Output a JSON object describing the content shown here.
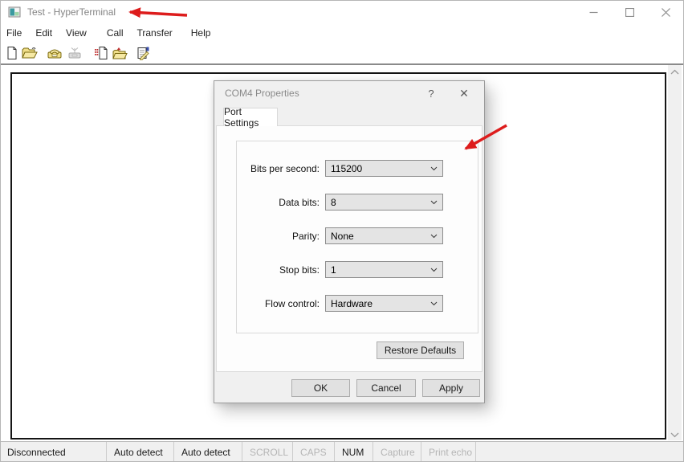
{
  "window": {
    "title": "Test - HyperTerminal"
  },
  "menu": {
    "items": [
      "File",
      "Edit",
      "View",
      "Call",
      "Transfer",
      "Help"
    ]
  },
  "toolbar": {
    "icons": [
      "new-document",
      "open-folder",
      "connect-phone",
      "disconnect-phone",
      "send-file",
      "receive-folder",
      "properties"
    ]
  },
  "dialog": {
    "title": "COM4 Properties",
    "help_glyph": "?",
    "close_glyph": "✕",
    "tab": "Port Settings",
    "fields": [
      {
        "label": "Bits per second:",
        "value": "115200"
      },
      {
        "label": "Data bits:",
        "value": "8"
      },
      {
        "label": "Parity:",
        "value": "None"
      },
      {
        "label": "Stop bits:",
        "value": "1"
      },
      {
        "label": "Flow control:",
        "value": "Hardware"
      }
    ],
    "restore_defaults": "Restore Defaults",
    "buttons": {
      "ok": "OK",
      "cancel": "Cancel",
      "apply": "Apply"
    }
  },
  "statusbar": {
    "segments": [
      {
        "label": "Disconnected",
        "enabled": true
      },
      {
        "label": "Auto detect",
        "enabled": true
      },
      {
        "label": "Auto detect",
        "enabled": true
      },
      {
        "label": "SCROLL",
        "enabled": false
      },
      {
        "label": "CAPS",
        "enabled": false
      },
      {
        "label": "NUM",
        "enabled": true
      },
      {
        "label": "Capture",
        "enabled": false
      },
      {
        "label": "Print echo",
        "enabled": false
      }
    ]
  },
  "colors": {
    "annotation_arrow": "#dd1c1c",
    "app_icon_teal": "#3a9aa0",
    "toolbar_yellow": "#f0df8a",
    "dialog_background": "#f0f0f0",
    "combo_background": "#e4e4e4"
  }
}
